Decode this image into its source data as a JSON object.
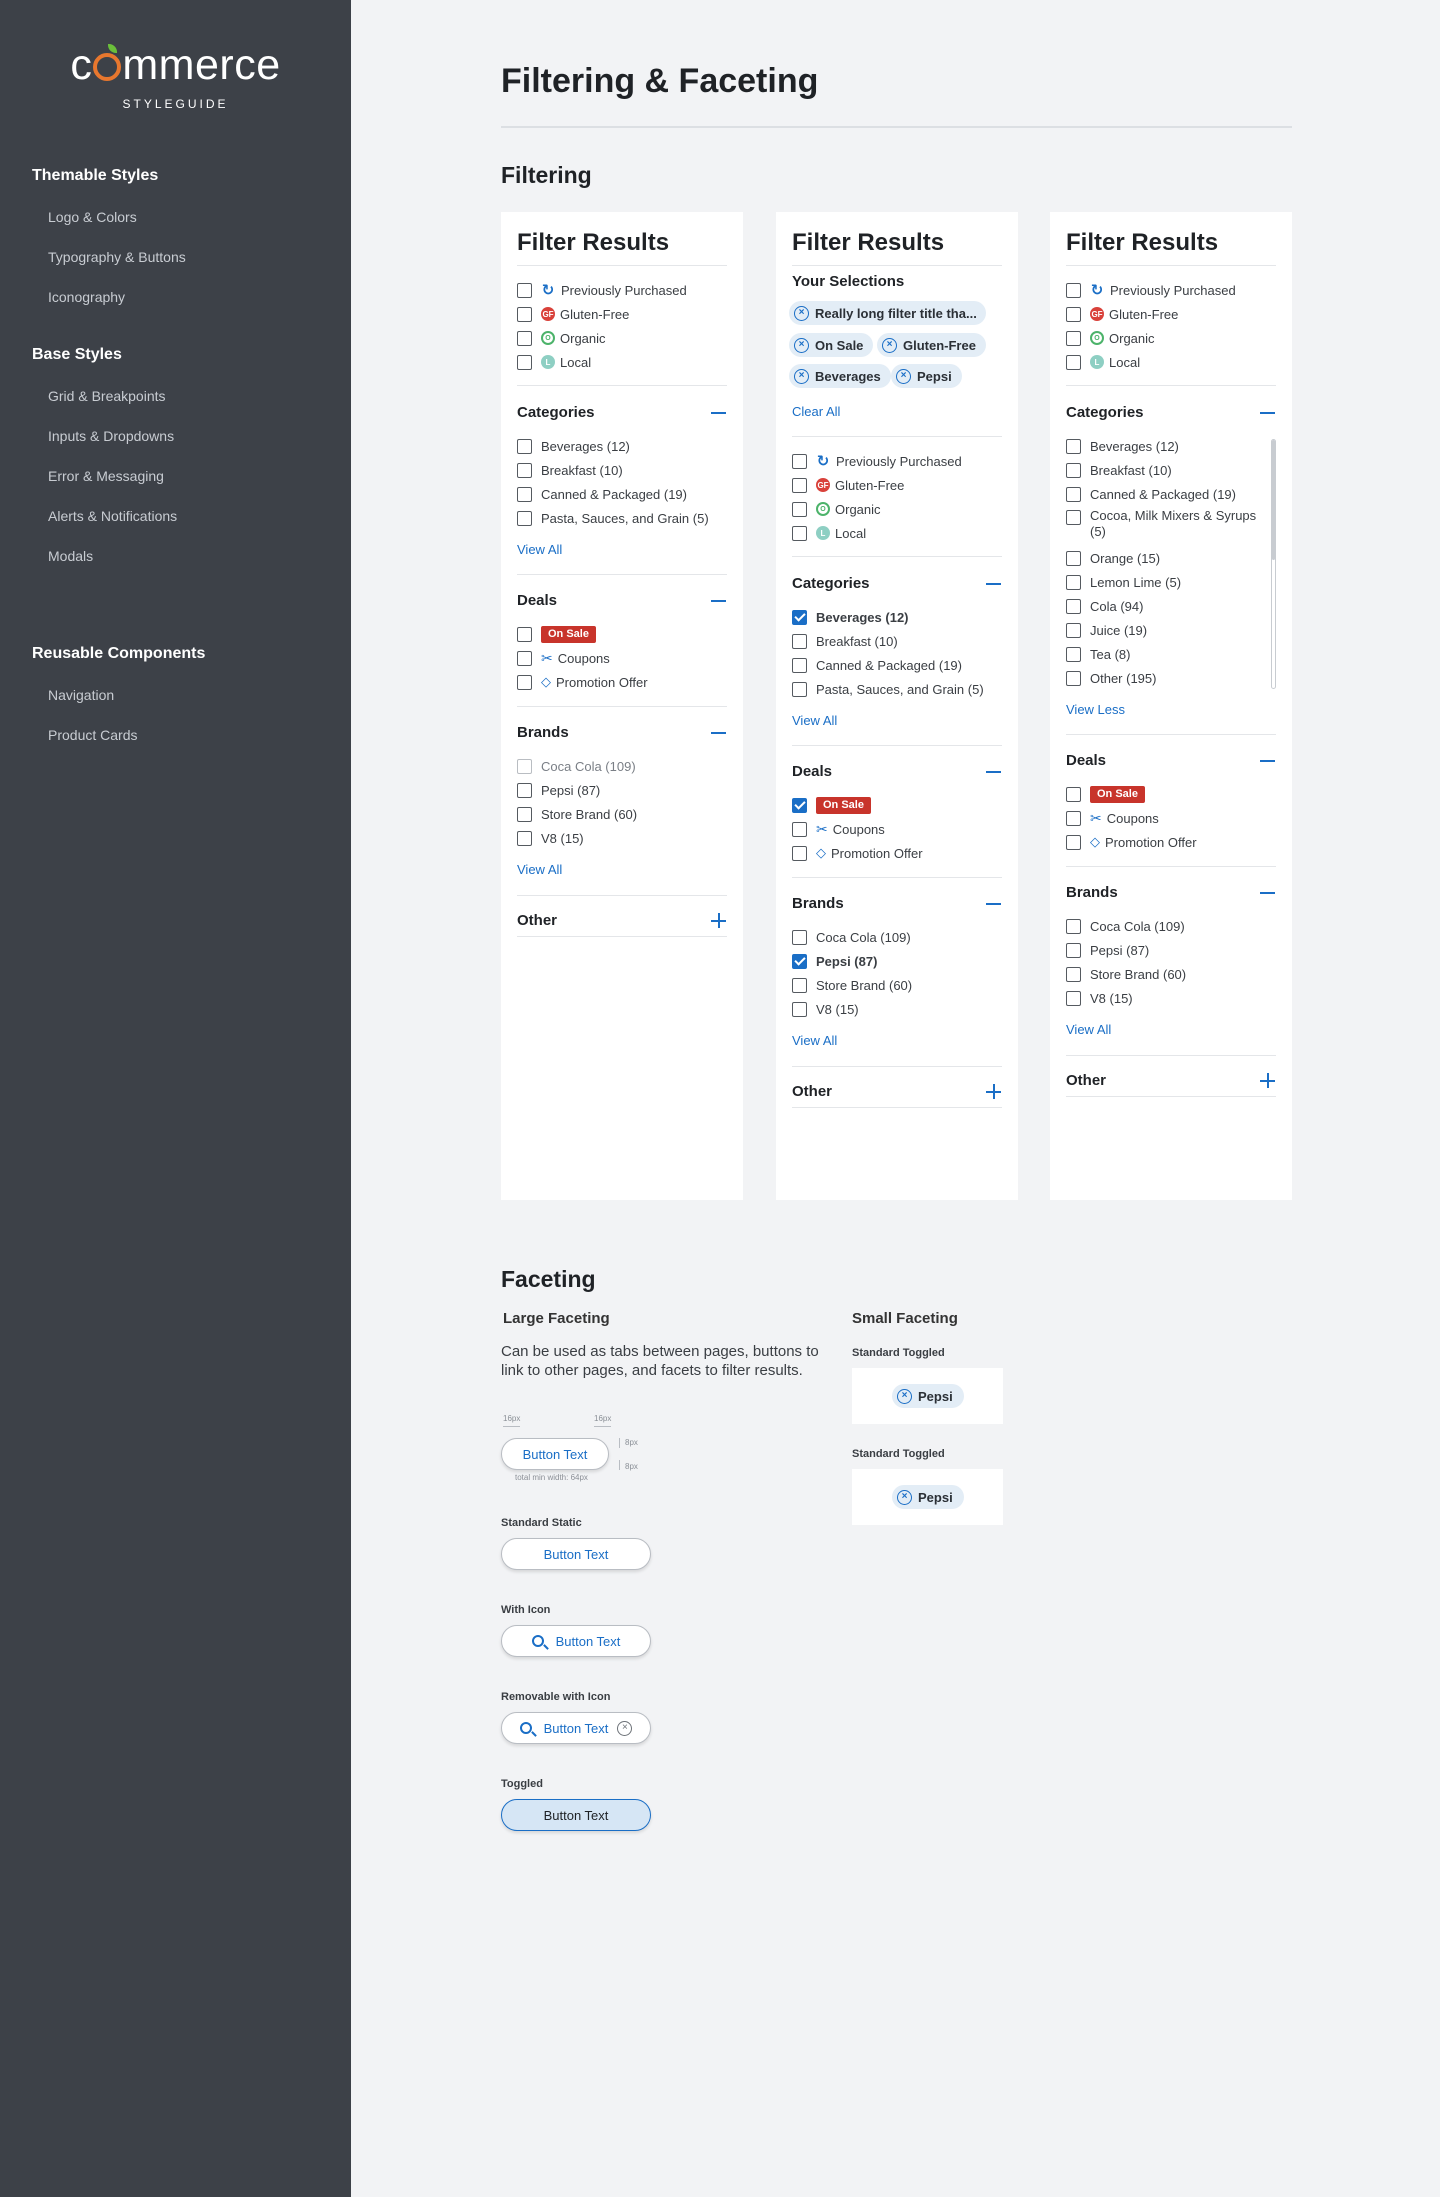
{
  "brand": {
    "logo_pre": "c",
    "logo_post": "mmerce",
    "subtitle": "STYLEGUIDE",
    "accent": "#e8772e",
    "leaf": "#6bbf3a"
  },
  "sidebar": {
    "groups": [
      {
        "title": "Themable Styles",
        "items": [
          "Logo & Colors",
          "Typography & Buttons",
          "Iconography"
        ]
      },
      {
        "title": "Base Styles",
        "items": [
          "Grid & Breakpoints",
          "Inputs & Dropdowns",
          "Error & Messaging",
          "Alerts & Notifications",
          "Modals"
        ]
      },
      {
        "title": "Reusable Components",
        "items": [
          "Navigation",
          "Product Cards"
        ]
      }
    ]
  },
  "page": {
    "title": "Filtering & Faceting",
    "filtering": "Filtering",
    "faceting": "Faceting"
  },
  "filters": {
    "title": "Filter Results",
    "attrs": [
      "Previously Purchased",
      "Gluten-Free",
      "Organic",
      "Local"
    ],
    "attr_icons": [
      "refresh-icon",
      "gf-icon",
      "organic-icon",
      "local-icon"
    ],
    "attr_glyphs": [
      "↻",
      "GF",
      "O",
      "L"
    ],
    "categories": "Categories",
    "deals": "Deals",
    "brands": "Brands",
    "other": "Other",
    "view_all": "View All",
    "view_less": "View Less",
    "on_sale": "On Sale",
    "coupons": "Coupons",
    "promo": "Promotion Offer",
    "cat_items": [
      "Beverages (12)",
      "Breakfast (10)",
      "Canned & Packaged (19)",
      "Pasta, Sauces, and Grain (5)"
    ],
    "cat_expanded": [
      "Beverages (12)",
      "Breakfast (10)",
      "Canned & Packaged (19)",
      "Cocoa, Milk Mixers & Syrups (5)",
      "Orange (15)",
      "Lemon Lime (5)",
      "Cola (94)",
      "Juice (19)",
      "Tea (8)",
      "Other (195)"
    ],
    "brand_items": [
      "Coca Cola (109)",
      "Pepsi (87)",
      "Store Brand (60)",
      "V8 (15)"
    ],
    "your_selections": "Your Selections",
    "chips": [
      "Really long filter title tha...",
      "On Sale",
      "Gluten-Free",
      "Beverages",
      "Pepsi"
    ],
    "clear_all": "Clear All"
  },
  "faceting": {
    "large": "Large Faceting",
    "small": "Small Faceting",
    "desc": "Can be used as tabs between pages, buttons to link to other pages, and facets to filter results.",
    "spec": {
      "pad_l": "16px",
      "pad_r": "16px",
      "pad_t": "8px",
      "pad_b": "8px",
      "min": "total min width: 64px"
    },
    "button_text": "Button Text",
    "standard_static": "Standard Static",
    "with_icon": "With Icon",
    "removable": "Removable with Icon",
    "toggled": "Toggled",
    "standard_toggled": "Standard Toggled",
    "pepsi": "Pepsi"
  }
}
